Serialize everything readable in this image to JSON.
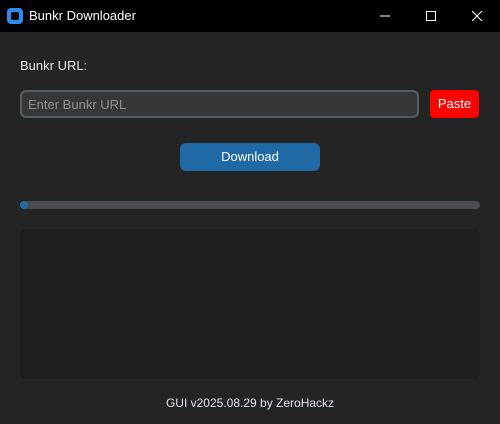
{
  "window": {
    "title": "Bunkr Downloader",
    "icon": "app-icon"
  },
  "form": {
    "url_label": "Bunkr URL:",
    "url_value": "",
    "url_placeholder": "Enter Bunkr URL",
    "paste_label": "Paste",
    "download_label": "Download"
  },
  "progress": {
    "value_percent": 1.7
  },
  "log": {
    "text": ""
  },
  "footer": {
    "text": "GUI v2025.08.29 by ZeroHackz"
  },
  "colors": {
    "background": "#242424",
    "titlebar": "#000000",
    "accent_blue": "#1f6aa5",
    "paste_red": "#ff0000",
    "log_background": "#1d1e1e"
  }
}
